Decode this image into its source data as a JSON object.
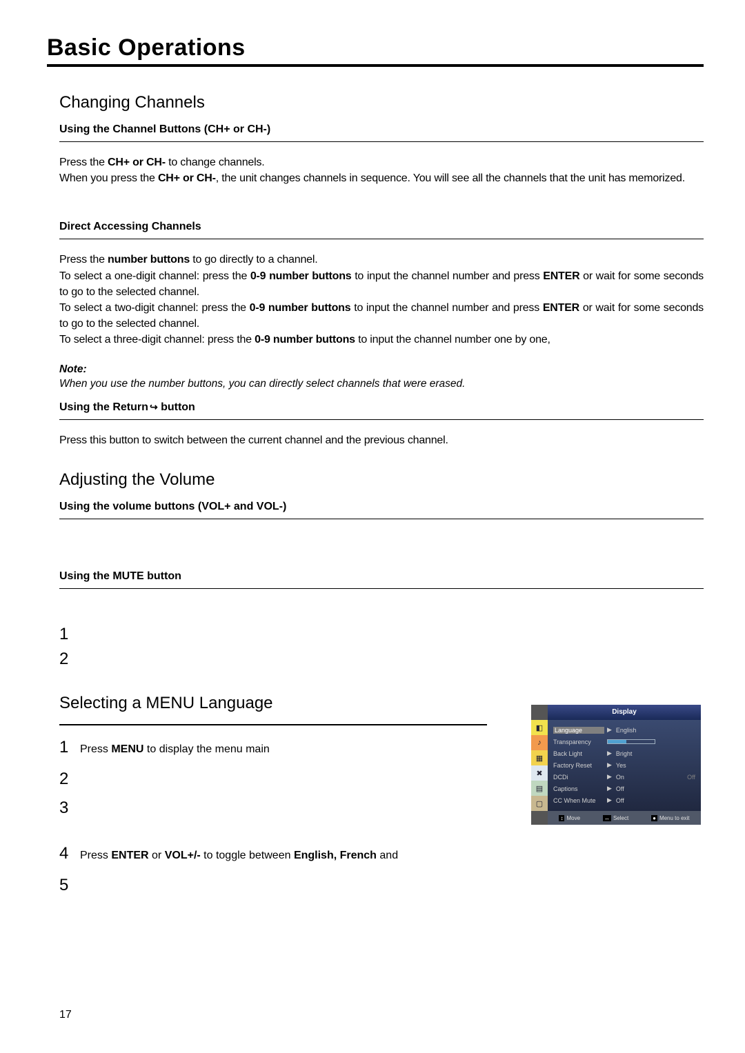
{
  "pageTitle": "Basic Operations",
  "pageNum": "17",
  "s1": {
    "heading": "Changing Channels",
    "sub1": "Using the Channel Buttons (CH+ or CH-)",
    "p1a": "Press the ",
    "p1b": "CH+ or CH-",
    "p1c": "  to change channels.",
    "p2a": "When you press the ",
    "p2b": "CH+ or CH-",
    "p2c": ", the unit changes channels in sequence. You will see all the channels that the unit has memorized.",
    "sub2": "Direct Accessing Channels",
    "d1a": "Press the ",
    "d1b": "number buttons",
    "d1c": " to go directly to a channel.",
    "d2a": "To select a one-digit channel: press the ",
    "d2b": "0-9 number buttons",
    "d2c": " to input the channel number and press ",
    "d2d": "ENTER",
    "d2e": " or wait for some seconds to go to the selected channel.",
    "d3a": "To select a two-digit channel: press the ",
    "d3b": "0-9 number buttons",
    "d3c": " to input the channel number and press ",
    "d3d": "ENTER",
    "d3e": " or wait for some seconds to go to the selected channel.",
    "d4a": "To select a three-digit channel:  press the ",
    "d4b": "0-9 number buttons",
    "d4c": " to input the channel number one by one,",
    "noteLabel": "Note:",
    "noteText": "When you use the number buttons, you can directly select channels  that  were erased.",
    "sub3a": "Using the Return   ",
    "sub3b": "button",
    "retP": "Press this button to switch between the current channel and the  previous channel."
  },
  "s2": {
    "heading": "Adjusting the Volume",
    "sub1": "Using the volume buttons (VOL+ and VOL-)",
    "sub2": "Using the MUTE button",
    "step1": "1",
    "step2": "2"
  },
  "s3": {
    "heading": "Selecting a MENU Language",
    "st1n": "1",
    "st1a": "Press  ",
    "st1b": "MENU",
    "st1c": " to display the menu main",
    "st2n": "2",
    "st3n": "3",
    "st4n": "4",
    "st4a": "Press ",
    "st4b": "ENTER",
    "st4c": " or ",
    "st4d": "VOL+/-",
    "st4e": "  to toggle between ",
    "st4f": "English, French",
    "st4g": " and",
    "st5n": "5"
  },
  "osd": {
    "title": "Display",
    "rows": {
      "r1l": "Language",
      "r1v": "English",
      "r2l": "Transparency",
      "r3l": "Back Light",
      "r3v": "Bright",
      "r4l": "Factory Reset",
      "r4v": "Yes",
      "r5l": "DCDi",
      "r5v": "On",
      "r5x": "Off",
      "r6l": "Captions",
      "r6v": "Off",
      "r7l": "CC When Mute",
      "r7v": "Off"
    },
    "foot": {
      "a": "Move",
      "b": "Select",
      "c": "Menu to exit"
    }
  }
}
